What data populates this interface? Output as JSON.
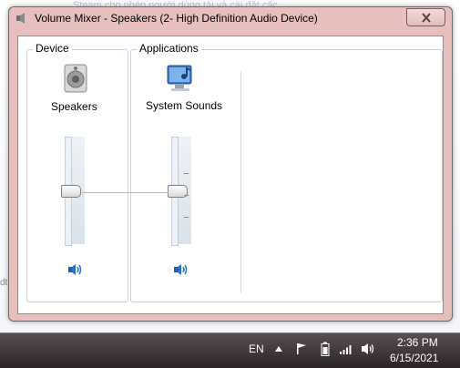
{
  "background": {
    "snippet": "Steam cho phép người dùng tải và cài đặt cấc",
    "side_text": "dt"
  },
  "window": {
    "title": "Volume Mixer - Speakers (2- High Definition Audio Device)",
    "frame_color": "#e6bfbe",
    "close_icon": "close-icon"
  },
  "device": {
    "group_label": "Device",
    "name": "Speakers",
    "icon": "speaker-icon",
    "volume_percent": 50,
    "mute_icon": "speaker-volume-icon"
  },
  "applications": {
    "group_label": "Applications",
    "items": [
      {
        "name": "System Sounds",
        "icon": "system-sounds-icon",
        "volume_percent": 50,
        "mute_icon": "speaker-volume-icon"
      }
    ]
  },
  "taskbar": {
    "language": "EN",
    "time": "2:36 PM",
    "date": "6/15/2021",
    "tray_icons": [
      "show-hidden-icons-icon",
      "action-center-flag-icon",
      "battery-icon",
      "network-signal-icon",
      "volume-icon"
    ]
  }
}
